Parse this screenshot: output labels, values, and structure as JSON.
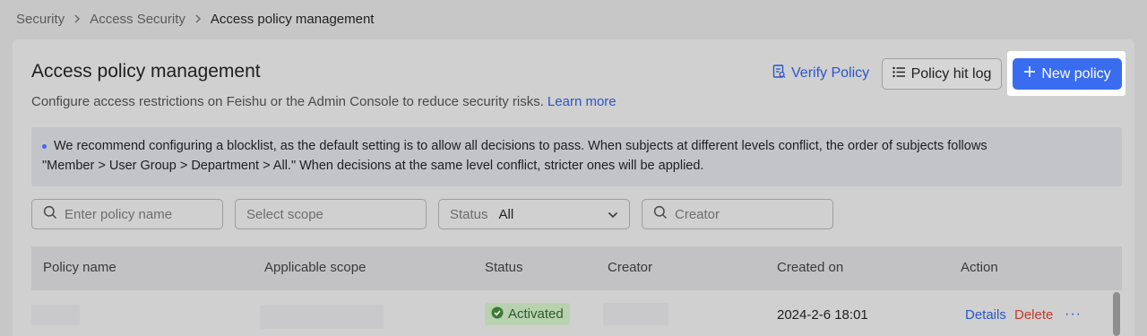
{
  "breadcrumb": [
    "Security",
    "Access Security",
    "Access policy management"
  ],
  "page": {
    "title": "Access policy management",
    "description": "Configure access restrictions on Feishu or the Admin Console to reduce security risks.",
    "learn_more": "Learn more"
  },
  "actions": {
    "verify": "Verify Policy",
    "hit_log": "Policy hit log",
    "new_policy": "New policy"
  },
  "notice": {
    "line1": "We recommend configuring a blocklist, as the default setting is to allow all decisions to pass. When subjects at different levels conflict, the order of subjects follows",
    "line2": "\"Member > User Group > Department > All.\" When decisions at the same level conflict, stricter ones will be applied."
  },
  "filters": {
    "policy_name_placeholder": "Enter policy name",
    "scope_placeholder": "Select scope",
    "status_label": "Status",
    "status_value": "All",
    "creator_placeholder": "Creator"
  },
  "table": {
    "headers": [
      "Policy name",
      "Applicable scope",
      "Status",
      "Creator",
      "Created on",
      "Action"
    ],
    "rows": [
      {
        "status": "Activated",
        "created_on": "2024-2-6 18:01",
        "actions": [
          "Details",
          "Delete",
          "···"
        ]
      }
    ]
  },
  "colors": {
    "accent": "#3a6cf0",
    "link": "#2b56c9",
    "danger": "#c43a2e",
    "success": "#2d5b2a"
  }
}
